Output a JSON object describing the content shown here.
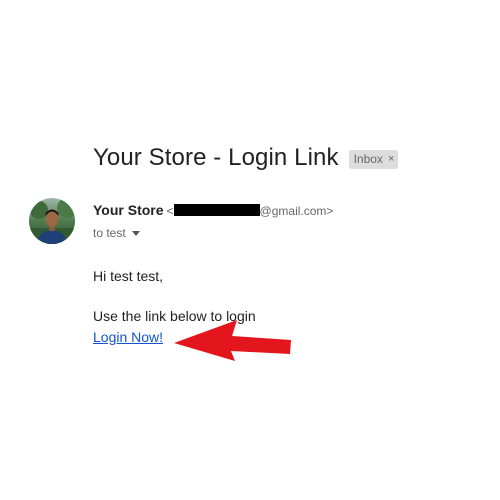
{
  "email": {
    "subject": "Your Store - Login Link",
    "label": "Inbox",
    "label_close": "×",
    "sender_name": "Your Store",
    "sender_email_open": "<",
    "sender_email_domain": "@gmail.com>",
    "recipient_line": "to test",
    "greeting": "Hi test test,",
    "instruction": "Use the link below to login",
    "link_text": "Login Now!"
  },
  "colors": {
    "subject_text": "#222222",
    "secondary_text": "#666666",
    "link": "#1155cc",
    "label_chip_bg": "#dddddd",
    "arrow": "#e4161d",
    "redaction": "#000000"
  },
  "icons": {
    "avatar": "sender-avatar-photo",
    "recipient_toggle": "caret-down-icon",
    "annotation": "red-arrow-annotation"
  }
}
